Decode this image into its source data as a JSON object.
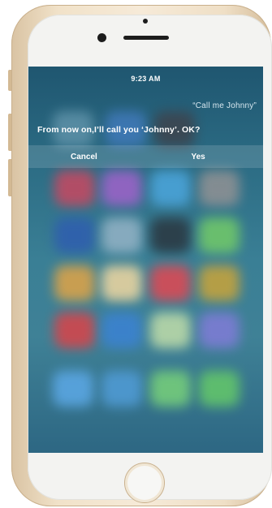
{
  "status_bar": {
    "time": "9:23 AM"
  },
  "siri": {
    "user_utterance": "“Call me Johnny”",
    "response": "From now on,I’ll call you ‘Johnny’. OK?",
    "actions": {
      "cancel_label": "Cancel",
      "confirm_label": "Yes"
    }
  },
  "device": {
    "model": "iPhone",
    "frame_color": "#f1e2c9",
    "face_color": "#f3f3f1"
  },
  "colors": {
    "screen_top": "#1f5670",
    "screen_bottom": "#2d6783",
    "text": "#ffffff"
  }
}
